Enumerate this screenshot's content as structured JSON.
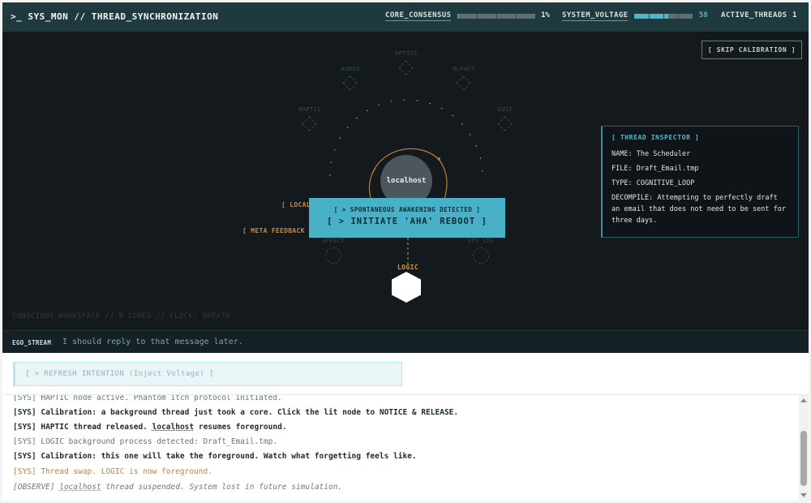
{
  "header": {
    "title": ">_ SYS_MON // THREAD_SYNCHRONIZATION",
    "core_consensus_label": "CORE_CONSENSUS",
    "core_consensus_value": "1%",
    "core_consensus_fraction": 0.01,
    "system_voltage_label": "SYSTEM_VOLTAGE",
    "system_voltage_value": "58",
    "system_voltage_fraction": 0.58,
    "active_threads_label": "ACTIVE_THREADS",
    "active_threads_value": "1"
  },
  "stage": {
    "skip_label": "[ SKIP CALIBRATION ]",
    "nodes": {
      "optics": "OPTICS",
      "audio": "AUDIO",
      "olfact": "OLFACT",
      "haptic": "HAPTIC",
      "gust": "GUST",
      "affect": "AFFECT",
      "sys_log": "SYS_LOG"
    },
    "localhost_label": "localhost",
    "local_tag": "[ LOCAL",
    "meta_tag": "[ META FEEDBACK TR",
    "aha_sub": "[ > SPONTANEOUS AWAKENING DETECTED ]",
    "aha_main": "[ > INITIATE 'AHA' REBOOT ]",
    "logic_label": "LOGIC",
    "workspace_text": "CONSCIOUS_WORKSPACE // 8 CORES // CLOCK: BREATH"
  },
  "inspector": {
    "title": "[ THREAD INSPECTOR ]",
    "name_key": "NAME:",
    "name_value": "The Scheduler",
    "file_key": "FILE:",
    "file_value": "Draft_Email.tmp",
    "type_key": "TYPE:",
    "type_value": "COGNITIVE_LOOP",
    "decompile_key": "DECOMPILE:",
    "decompile_value": "Attempting to perfectly draft an email that does not need to be sent for three days."
  },
  "ego": {
    "key": "EGO_STREAM",
    "text": "I should reply to that message later."
  },
  "actions": {
    "refresh_label": "[ > REFRESH INTENTION (Inject Voltage) ]"
  },
  "console": {
    "lines": [
      {
        "prefix": "[SYS]",
        "text": "HAPTIC node active. Phantom itch protocol initiated."
      },
      {
        "prefix": "[SYS]",
        "text": "Calibration: a background thread just took a core. Click the lit node to NOTICE & RELEASE."
      },
      {
        "prefix": "[SYS]",
        "text_a": "HAPTIC thread released.",
        "link": "localhost",
        "text_b": "resumes foreground."
      },
      {
        "prefix": "[SYS]",
        "text": "LOGIC background process detected: Draft_Email.tmp."
      },
      {
        "prefix": "[SYS]",
        "text": "Calibration: this one will take the foreground. Watch what forgetting feels like."
      },
      {
        "prefix": "[SYS]",
        "text": "Thread swap. LOGIC is now foreground."
      },
      {
        "prefix": "[OBSERVE]",
        "link": "localhost",
        "text": "thread suspended. System lost in future simulation."
      }
    ]
  },
  "colors": {
    "header_bg": "#1f3a3f",
    "stage_bg": "#13191d",
    "accent_cyan": "#48b1c7",
    "accent_orange": "#c98a3c"
  }
}
